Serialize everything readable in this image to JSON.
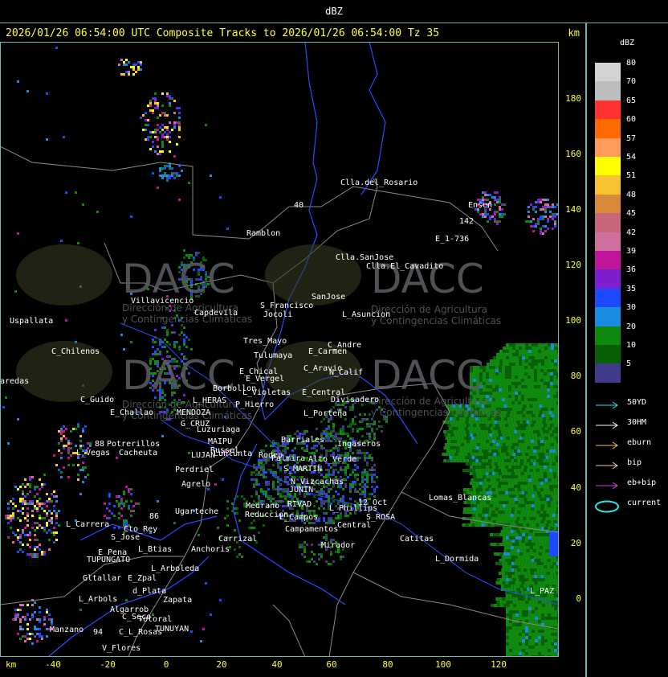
{
  "header": {
    "unit": "dBZ",
    "title": "2026/01/26 06:54:00 UTC Composite Tracks to 2026/01/26 06:54:00 Tz 35",
    "km_label": "km"
  },
  "axes": {
    "x_label": "km",
    "x_ticks": [
      "-40",
      "-20",
      "0",
      "20",
      "40",
      "60",
      "80",
      "100",
      "120"
    ],
    "y_label": "km",
    "y_ticks": [
      "180",
      "160",
      "140",
      "120",
      "100",
      "80",
      "60",
      "40",
      "20",
      "0"
    ]
  },
  "legend": {
    "title": "dBZ",
    "levels": [
      {
        "label": "80",
        "color": "#d3d3d3"
      },
      {
        "label": "70",
        "color": "#bdbdbd"
      },
      {
        "label": "65",
        "color": "#ff3131"
      },
      {
        "label": "60",
        "color": "#ff6a00"
      },
      {
        "label": "57",
        "color": "#ff9a5a"
      },
      {
        "label": "54",
        "color": "#ffff00"
      },
      {
        "label": "51",
        "color": "#f7c130"
      },
      {
        "label": "48",
        "color": "#d88a3a"
      },
      {
        "label": "45",
        "color": "#c8667a"
      },
      {
        "label": "42",
        "color": "#d070a0"
      },
      {
        "label": "39",
        "color": "#c0169a"
      },
      {
        "label": "36",
        "color": "#7d1ed0"
      },
      {
        "label": "35",
        "color": "#1e4aff"
      },
      {
        "label": "30",
        "color": "#1a8de0"
      },
      {
        "label": "20",
        "color": "#0f8a0f"
      },
      {
        "label": "10",
        "color": "#075f07"
      },
      {
        "label": "5",
        "color": "#3f3a8a"
      }
    ],
    "tracks": [
      {
        "label": "50YD",
        "color": "#2ee8e8"
      },
      {
        "label": "30HM",
        "color": "#ffffff"
      },
      {
        "label": "eburn",
        "color": "#f0c060"
      },
      {
        "label": "bip",
        "color": "#f4c8b4"
      },
      {
        "label": "eb+bip",
        "color": "#e040e0"
      },
      {
        "label": "current",
        "color": "#2ee8e8"
      }
    ]
  },
  "watermark": {
    "brand": "DACC",
    "subtitle_line1": "Dirección de Agricultura",
    "subtitle_line2": "y Contingencias Climáticas"
  },
  "places": [
    {
      "name": "Clla.del_Rosario"
    },
    {
      "name": "Ramblon"
    },
    {
      "name": "Clla.SanJose"
    },
    {
      "name": "Clla.El_Cavadito"
    },
    {
      "name": "Villavicencio"
    },
    {
      "name": "Uspallata"
    },
    {
      "name": "Capdevila"
    },
    {
      "name": "S_Francisco"
    },
    {
      "name": "Jocoli"
    },
    {
      "name": "SanJose"
    },
    {
      "name": "L_Asuncion"
    },
    {
      "name": "C_Chilenos"
    },
    {
      "name": "Tres_Mayo"
    },
    {
      "name": "Tulumaya"
    },
    {
      "name": "C_Andre"
    },
    {
      "name": "E_Carmen"
    },
    {
      "name": "E_Chical"
    },
    {
      "name": "E_Vergel"
    },
    {
      "name": "C_Aravio"
    },
    {
      "name": "N_Calif"
    },
    {
      "name": "Borbollon"
    },
    {
      "name": "L_Violetas"
    },
    {
      "name": "E_Central"
    },
    {
      "name": "Divisadero"
    },
    {
      "name": "C_Guido"
    },
    {
      "name": "L_HERAS"
    },
    {
      "name": "P_Hierro"
    },
    {
      "name": "L_Porteña"
    },
    {
      "name": "E_Challao"
    },
    {
      "name": "MENDOZA"
    },
    {
      "name": "G_CRUZ"
    },
    {
      "name": "Luzuriaga"
    },
    {
      "name": "Potrerillos"
    },
    {
      "name": "L_Vegas"
    },
    {
      "name": "Cacheuta"
    },
    {
      "name": "MAIPU"
    },
    {
      "name": "Russel"
    },
    {
      "name": "LUJAN"
    },
    {
      "name": "Lunlunta"
    },
    {
      "name": "Perdriel"
    },
    {
      "name": "Agrelo"
    },
    {
      "name": "S_MARTIN"
    },
    {
      "name": "Rodeo"
    },
    {
      "name": "Palmira"
    },
    {
      "name": "Barriales"
    },
    {
      "name": "Ingaseros"
    },
    {
      "name": "Alto_Verde"
    },
    {
      "name": "N_Vizcachas"
    },
    {
      "name": "JUNIN"
    },
    {
      "name": "RIVAD"
    },
    {
      "name": "L_Phillips"
    },
    {
      "name": "12_Oct"
    },
    {
      "name": "Medrano"
    },
    {
      "name": "Reduccion"
    },
    {
      "name": "L_Campos"
    },
    {
      "name": "Campamentos"
    },
    {
      "name": "Central"
    },
    {
      "name": "S_ROSA"
    },
    {
      "name": "Lomas_Blancas"
    },
    {
      "name": "Catitas"
    },
    {
      "name": "Ugarteche"
    },
    {
      "name": "L_Carrera"
    },
    {
      "name": "Cto_Rey"
    },
    {
      "name": "S_Jose"
    },
    {
      "name": "Carrizal"
    },
    {
      "name": "Mirador"
    },
    {
      "name": "E_Pena"
    },
    {
      "name": "TUPUNGATO"
    },
    {
      "name": "L_Btias"
    },
    {
      "name": "Anchoris"
    },
    {
      "name": "L_Arboleda"
    },
    {
      "name": "L_Dormida"
    },
    {
      "name": "Gltallar"
    },
    {
      "name": "E_Zpal"
    },
    {
      "name": "d_Plata"
    },
    {
      "name": "L_Arbols"
    },
    {
      "name": "Zapata"
    },
    {
      "name": "Algarrob"
    },
    {
      "name": "C_Seco"
    },
    {
      "name": "Totoral"
    },
    {
      "name": "TUNUYAN"
    },
    {
      "name": "Manzano"
    },
    {
      "name": "C_L_Rosas"
    },
    {
      "name": "V_Flores"
    },
    {
      "name": "L_PAZ"
    },
    {
      "name": "E_1-736"
    },
    {
      "name": "Ensen"
    },
    {
      "name": "aredas"
    },
    {
      "name": "142"
    },
    {
      "name": "40"
    },
    {
      "name": "88"
    },
    {
      "name": "86"
    },
    {
      "name": "94"
    }
  ]
}
